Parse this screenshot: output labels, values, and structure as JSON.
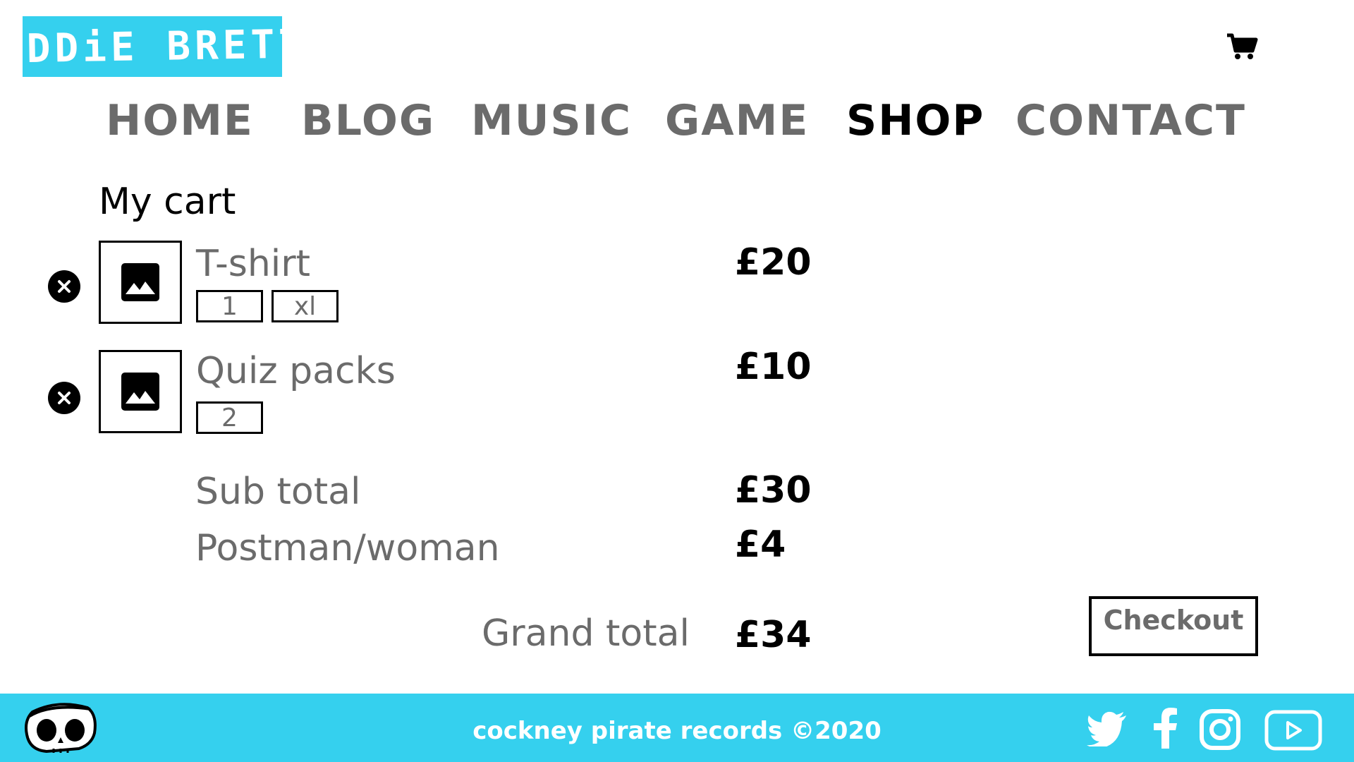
{
  "header": {
    "logo_text": "EDDiE BRETT",
    "cart_icon": "shopping-cart-icon"
  },
  "nav": {
    "items": [
      {
        "label": "HOME"
      },
      {
        "label": "BLOG"
      },
      {
        "label": "MUSIC"
      },
      {
        "label": "GAME"
      },
      {
        "label": "SHOP",
        "active": true
      },
      {
        "label": "CONTACT"
      }
    ]
  },
  "cart": {
    "title": "My cart",
    "items": [
      {
        "name": "T-shirt",
        "options": [
          "1",
          "xl"
        ],
        "price": "£20",
        "remove_icon": "close-circle-icon",
        "image_icon": "image-placeholder-icon"
      },
      {
        "name": "Quiz packs",
        "options": [
          "2"
        ],
        "price": "£10",
        "remove_icon": "close-circle-icon",
        "image_icon": "image-placeholder-icon"
      }
    ],
    "summary": {
      "subtotal_label": "Sub total",
      "subtotal_value": "£30",
      "postage_label": "Postman/woman",
      "postage_value": "£4",
      "grand_label": "Grand total",
      "grand_value": "£34"
    },
    "checkout_label": "Checkout"
  },
  "footer": {
    "text": "cockney pirate records ©2020",
    "mascot_icon": "pirate-skull-icon",
    "social": [
      "twitter-icon",
      "facebook-icon",
      "instagram-icon",
      "youtube-icon"
    ]
  },
  "colors": {
    "brand": "#35d0ee",
    "text_muted": "#6b6b6b",
    "text_dark": "#000000"
  }
}
